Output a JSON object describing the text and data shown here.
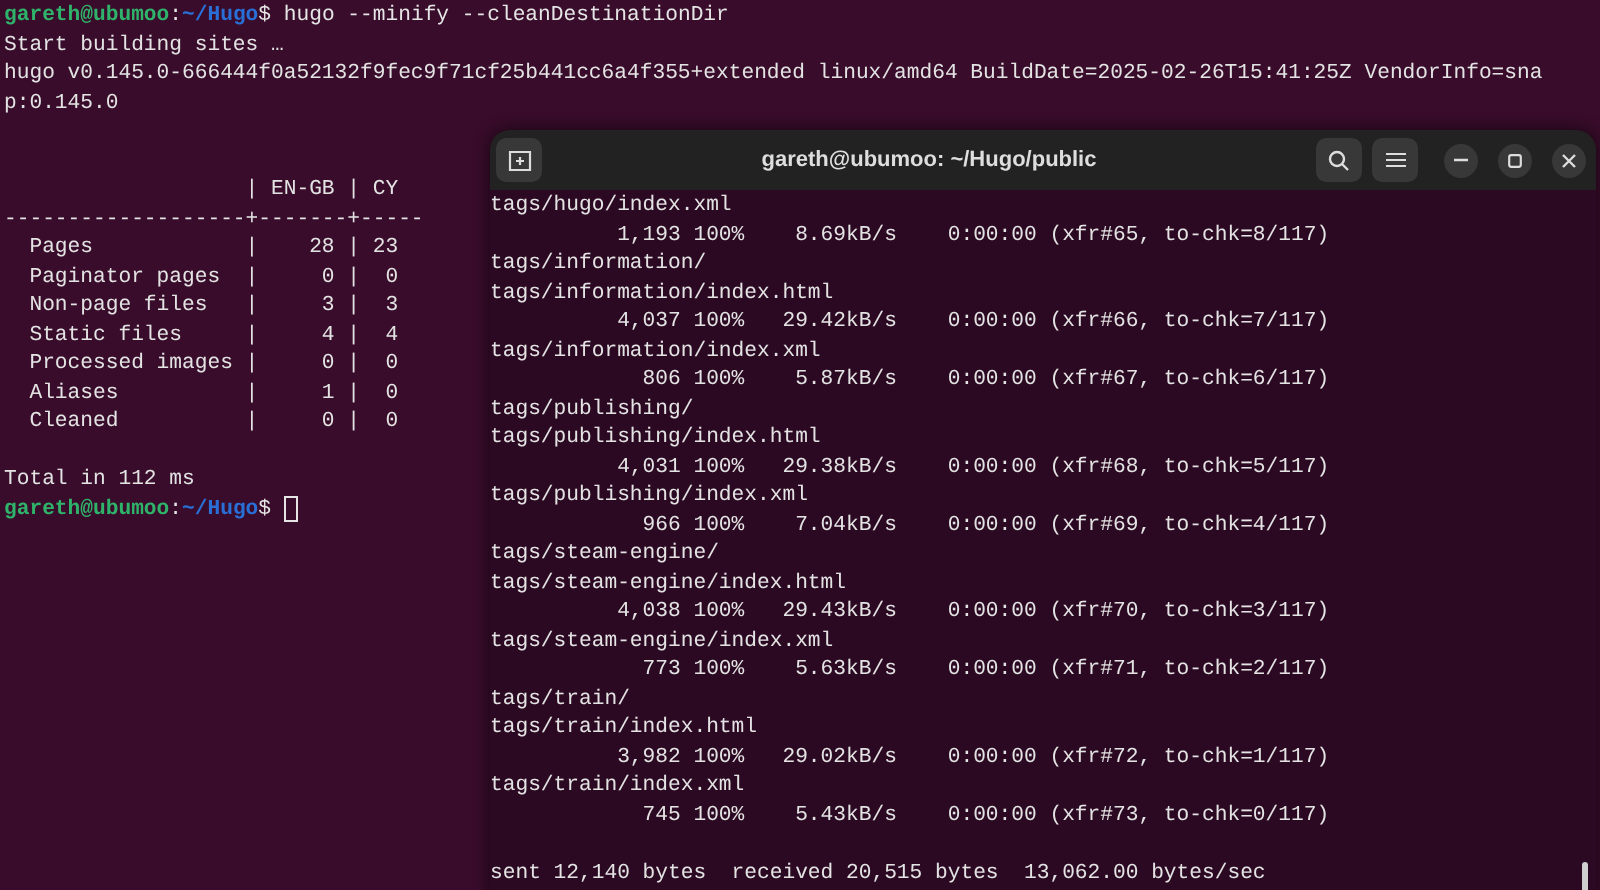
{
  "back_terminal": {
    "lines": [
      {
        "kind": "prompt",
        "user": "gareth@ubumoo",
        "colon": ":",
        "path": "~/Hugo",
        "symbol": "$",
        "command": "hugo --minify --cleanDestinationDir",
        "cursor": false
      },
      {
        "kind": "output",
        "text": "Start building sites …"
      },
      {
        "kind": "output",
        "text": "hugo v0.145.0-666444f0a52132f9fec9f71cf25b441cc6a4f355+extended linux/amd64 BuildDate=2025-02-26T15:41:25Z VendorInfo=sna"
      },
      {
        "kind": "output",
        "text": "p:0.145.0"
      },
      {
        "kind": "blank"
      },
      {
        "kind": "blank"
      },
      {
        "kind": "table",
        "separator": "|",
        "rule": "-------------------+-------+-----",
        "columns": [
          "EN-GB",
          "CY"
        ],
        "rows": [
          {
            "label": "Pages",
            "values": [
              "28",
              "23"
            ]
          },
          {
            "label": "Paginator pages",
            "values": [
              "0",
              "0"
            ]
          },
          {
            "label": "Non-page files",
            "values": [
              "3",
              "3"
            ]
          },
          {
            "label": "Static files",
            "values": [
              "4",
              "4"
            ]
          },
          {
            "label": "Processed images",
            "values": [
              "0",
              "0"
            ]
          },
          {
            "label": "Aliases",
            "values": [
              "1",
              "0"
            ]
          },
          {
            "label": "Cleaned",
            "values": [
              "0",
              "0"
            ]
          }
        ]
      },
      {
        "kind": "blank"
      },
      {
        "kind": "output",
        "text": "Total in 112 ms"
      },
      {
        "kind": "prompt",
        "user": "gareth@ubumoo",
        "colon": ":",
        "path": "~/Hugo",
        "symbol": "$",
        "cursor": true
      }
    ]
  },
  "front_window": {
    "title": "gareth@ubumoo: ~/Hugo/public",
    "lines": [
      {
        "kind": "path",
        "text": "tags/hugo/index.xml"
      },
      {
        "kind": "progress",
        "size": "1,193",
        "percent": "100%",
        "rate": "8.69kB/s",
        "elapsed": "0:00:00",
        "transfer": "(xfr#65, to-chk=8/117)"
      },
      {
        "kind": "path",
        "text": "tags/information/"
      },
      {
        "kind": "path",
        "text": "tags/information/index.html"
      },
      {
        "kind": "progress",
        "size": "4,037",
        "percent": "100%",
        "rate": "29.42kB/s",
        "elapsed": "0:00:00",
        "transfer": "(xfr#66, to-chk=7/117)"
      },
      {
        "kind": "path",
        "text": "tags/information/index.xml"
      },
      {
        "kind": "progress",
        "size": "806",
        "percent": "100%",
        "rate": "5.87kB/s",
        "elapsed": "0:00:00",
        "transfer": "(xfr#67, to-chk=6/117)"
      },
      {
        "kind": "path",
        "text": "tags/publishing/"
      },
      {
        "kind": "path",
        "text": "tags/publishing/index.html"
      },
      {
        "kind": "progress",
        "size": "4,031",
        "percent": "100%",
        "rate": "29.38kB/s",
        "elapsed": "0:00:00",
        "transfer": "(xfr#68, to-chk=5/117)"
      },
      {
        "kind": "path",
        "text": "tags/publishing/index.xml"
      },
      {
        "kind": "progress",
        "size": "966",
        "percent": "100%",
        "rate": "7.04kB/s",
        "elapsed": "0:00:00",
        "transfer": "(xfr#69, to-chk=4/117)"
      },
      {
        "kind": "path",
        "text": "tags/steam-engine/"
      },
      {
        "kind": "path",
        "text": "tags/steam-engine/index.html"
      },
      {
        "kind": "progress",
        "size": "4,038",
        "percent": "100%",
        "rate": "29.43kB/s",
        "elapsed": "0:00:00",
        "transfer": "(xfr#70, to-chk=3/117)"
      },
      {
        "kind": "path",
        "text": "tags/steam-engine/index.xml"
      },
      {
        "kind": "progress",
        "size": "773",
        "percent": "100%",
        "rate": "5.63kB/s",
        "elapsed": "0:00:00",
        "transfer": "(xfr#71, to-chk=2/117)"
      },
      {
        "kind": "path",
        "text": "tags/train/"
      },
      {
        "kind": "path",
        "text": "tags/train/index.html"
      },
      {
        "kind": "progress",
        "size": "3,982",
        "percent": "100%",
        "rate": "29.02kB/s",
        "elapsed": "0:00:00",
        "transfer": "(xfr#72, to-chk=1/117)"
      },
      {
        "kind": "path",
        "text": "tags/train/index.xml"
      },
      {
        "kind": "progress",
        "size": "745",
        "percent": "100%",
        "rate": "5.43kB/s",
        "elapsed": "0:00:00",
        "transfer": "(xfr#73, to-chk=0/117)"
      },
      {
        "kind": "blank"
      },
      {
        "kind": "path",
        "text": "sent 12,140 bytes  received 20,515 bytes  13,062.00 bytes/sec"
      }
    ]
  }
}
